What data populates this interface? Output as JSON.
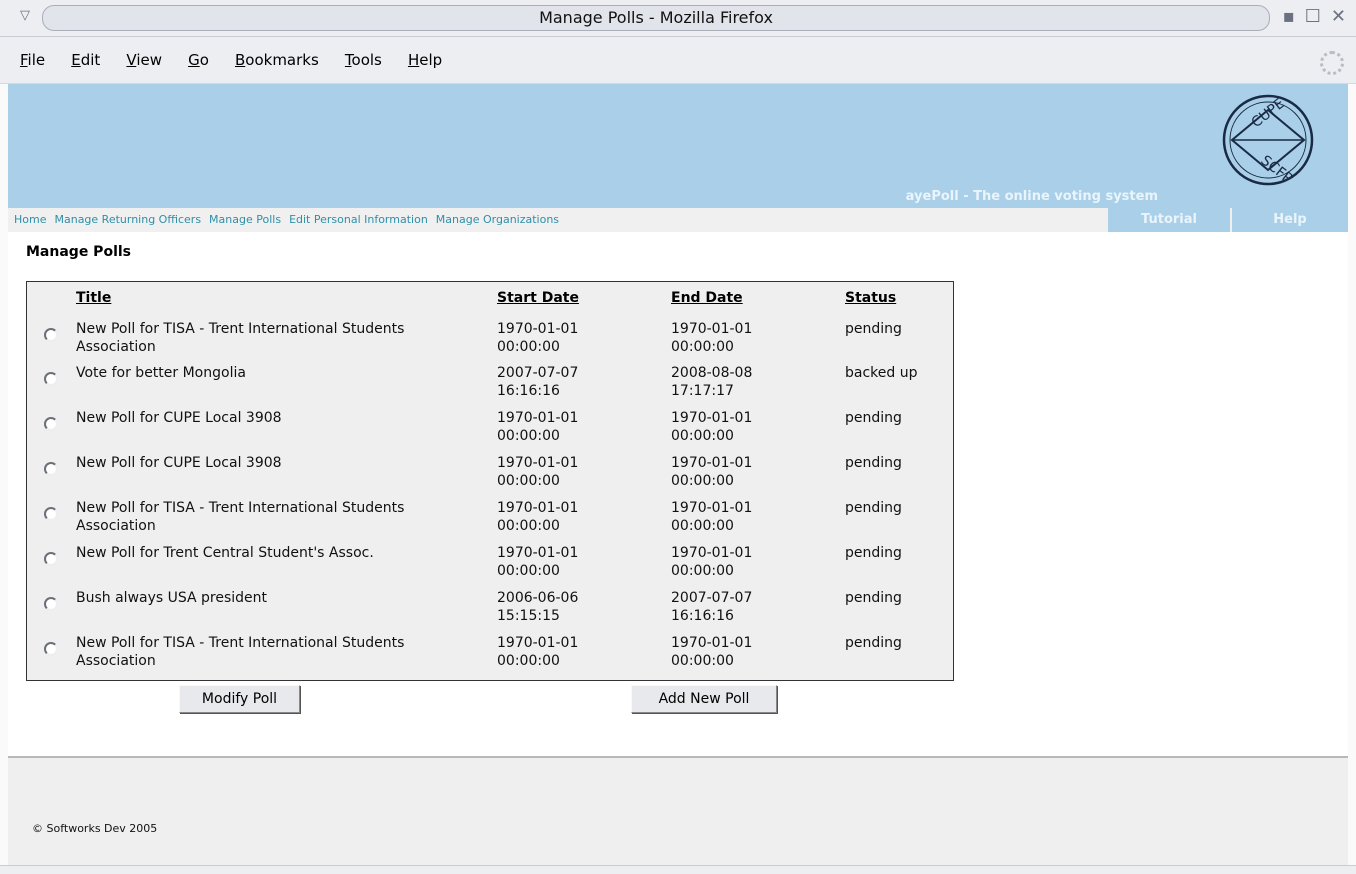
{
  "window": {
    "title": "Manage Polls - Mozilla Firefox",
    "controls": [
      "minimize-icon",
      "maximize-icon",
      "close-icon"
    ]
  },
  "menubar": {
    "items": [
      {
        "mnemonic": "F",
        "rest": "ile"
      },
      {
        "mnemonic": "E",
        "rest": "dit"
      },
      {
        "mnemonic": "V",
        "rest": "iew"
      },
      {
        "mnemonic": "G",
        "rest": "o"
      },
      {
        "mnemonic": "B",
        "rest": "ookmarks"
      },
      {
        "mnemonic": "T",
        "rest": "ools"
      },
      {
        "mnemonic": "H",
        "rest": "elp"
      }
    ]
  },
  "header": {
    "tagline": "ayePoll - The online voting system",
    "logo_text": "CUPE SCFP"
  },
  "nav": {
    "links": [
      "Home",
      "Manage Returning Officers",
      "Manage Polls",
      "Edit Personal Information",
      "Manage Organizations"
    ],
    "tutorial": "Tutorial",
    "help": "Help"
  },
  "page_title": "Manage Polls",
  "table": {
    "headers": {
      "title": "Title",
      "start": "Start Date",
      "end": "End Date",
      "status": "Status"
    },
    "rows": [
      {
        "title": "New Poll for TISA - Trent International Students Association",
        "start_date": "1970-01-01",
        "start_time": "00:00:00",
        "end_date": "1970-01-01",
        "end_time": "00:00:00",
        "status": "pending"
      },
      {
        "title": "Vote for better Mongolia",
        "start_date": "2007-07-07",
        "start_time": "16:16:16",
        "end_date": "2008-08-08",
        "end_time": "17:17:17",
        "status": "backed up"
      },
      {
        "title": "New Poll for CUPE Local 3908",
        "start_date": "1970-01-01",
        "start_time": "00:00:00",
        "end_date": "1970-01-01",
        "end_time": "00:00:00",
        "status": "pending"
      },
      {
        "title": "New Poll for CUPE Local 3908",
        "start_date": "1970-01-01",
        "start_time": "00:00:00",
        "end_date": "1970-01-01",
        "end_time": "00:00:00",
        "status": "pending"
      },
      {
        "title": "New Poll for TISA - Trent International Students Association",
        "start_date": "1970-01-01",
        "start_time": "00:00:00",
        "end_date": "1970-01-01",
        "end_time": "00:00:00",
        "status": "pending"
      },
      {
        "title": "New Poll for Trent Central Student's Assoc.",
        "start_date": "1970-01-01",
        "start_time": "00:00:00",
        "end_date": "1970-01-01",
        "end_time": "00:00:00",
        "status": "pending"
      },
      {
        "title": "Bush always USA president",
        "start_date": "2006-06-06",
        "start_time": "15:15:15",
        "end_date": "2007-07-07",
        "end_time": "16:16:16",
        "status": "pending"
      },
      {
        "title": "New Poll for TISA - Trent International Students Association",
        "start_date": "1970-01-01",
        "start_time": "00:00:00",
        "end_date": "1970-01-01",
        "end_time": "00:00:00",
        "status": "pending"
      }
    ]
  },
  "buttons": {
    "modify": "Modify Poll",
    "add": "Add New Poll"
  },
  "footer": {
    "copyright": "© Softworks Dev 2005"
  },
  "colors": {
    "header_bg": "#a9d0e8",
    "link": "#2f8fa8",
    "table_bg": "#efefef"
  }
}
